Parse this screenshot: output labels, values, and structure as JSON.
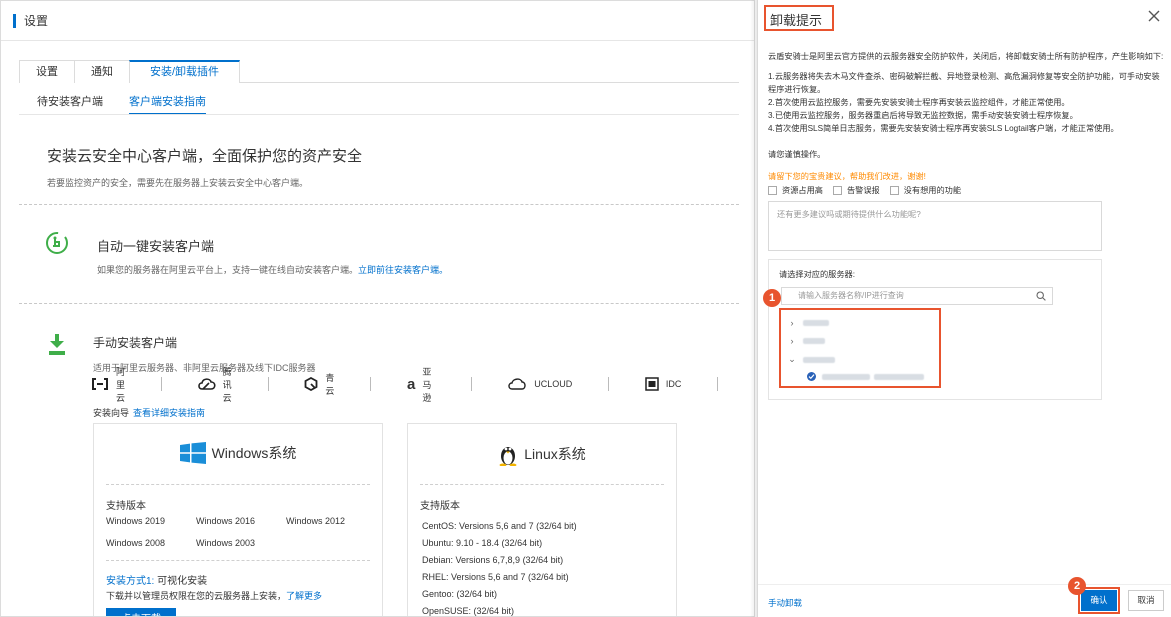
{
  "page": {
    "header_title": "设置",
    "tabs": [
      "设置",
      "通知",
      "安装/卸载插件"
    ],
    "active_tab": "安装/卸载插件",
    "subtabs": [
      "待安装客户端",
      "客户端安装指南"
    ],
    "active_subtab": "客户端安装指南",
    "hero": {
      "title": "安装云安全中心客户端，全面保护您的资产安全",
      "subtitle": "若要监控资产的安全，需要先在服务器上安装云安全中心客户端。"
    },
    "auto": {
      "title": "自动一键安装客户端",
      "desc": "如果您的服务器在阿里云平台上，支持一键在线自动安装客户端。",
      "link": "立即前往安装客户端。"
    },
    "manual": {
      "title": "手动安装客户端",
      "desc": "适用于阿里云服务器、非阿里云服务器及线下IDC服务器"
    },
    "vendors": [
      {
        "icon": "aliyun-icon",
        "label": "阿里云"
      },
      {
        "icon": "tencent-cloud-icon",
        "label": "腾讯云"
      },
      {
        "icon": "qingcloud-icon",
        "label": "青云"
      },
      {
        "icon": "amazon-icon",
        "label": "亚马逊"
      },
      {
        "icon": "ucloud-icon",
        "label": "UCLOUD"
      },
      {
        "icon": "idc-icon",
        "label": "IDC"
      }
    ],
    "guide": {
      "label": "安装向导",
      "link": "查看详细安装指南"
    },
    "windows": {
      "title": "Windows系统",
      "versions_label": "支持版本",
      "versions": [
        "Windows 2019",
        "Windows 2016",
        "Windows 2012",
        "Windows 2008",
        "Windows 2003"
      ],
      "mode_label": "安装方式1:",
      "mode_value": "可视化安装",
      "mode_desc": "下载并以管理员权限在您的云服务器上安装，",
      "mode_link": "了解更多",
      "download_label": "点击下载"
    },
    "linux": {
      "title": "Linux系统",
      "versions_label": "支持版本",
      "versions": [
        "CentOS: Versions 5,6 and 7 (32/64 bit)",
        "Ubuntu: 9.10 - 18.4 (32/64 bit)",
        "Debian: Versions 6,7,8,9 (32/64 bit)",
        "RHEL: Versions 5,6 and 7 (32/64 bit)",
        "Gentoo: (32/64 bit)",
        "OpenSUSE: (32/64 bit)"
      ]
    }
  },
  "drawer": {
    "title": "卸载提示",
    "intro": "云盾安骑士是阿里云官方提供的云服务器安全防护软件，关闭后，将卸载安骑士所有防护程序，产生影响如下:",
    "impacts": [
      "1.云服务器将失去木马文件查杀、密码破解拦截、异地登录检测、高危漏洞修复等安全防护功能，可手动安装程序进行恢复。",
      "2.首次使用云监控服务，需要先安装安骑士程序再安装云监控组件，才能正常使用。",
      "3.已使用云监控服务，服务器重启后将导致无监控数据，需手动安装安骑士程序恢复。",
      "4.首次使用SLS简单日志服务，需要先安装安骑士程序再安装SLS Logtail客户端，才能正常使用。"
    ],
    "caution": "请您谨慎操作。",
    "suggest": "请留下您的宝贵建议，帮助我们改进，谢谢!",
    "reasons": [
      "资源占用高",
      "告警误报",
      "没有想用的功能"
    ],
    "textarea_placeholder": "还有更多建议吗或期待提供什么功能呢?",
    "server_label": "请选择对应的服务器:",
    "search_placeholder": "请输入服务器名称/IP进行查询",
    "manual_uninstall": "手动卸载",
    "ok_label": "确认",
    "cancel_label": "取消",
    "markers": [
      "1",
      "2"
    ]
  },
  "colors": {
    "primary": "#0070cc",
    "highlight": "#e8542e",
    "warning": "#ff8a00"
  }
}
